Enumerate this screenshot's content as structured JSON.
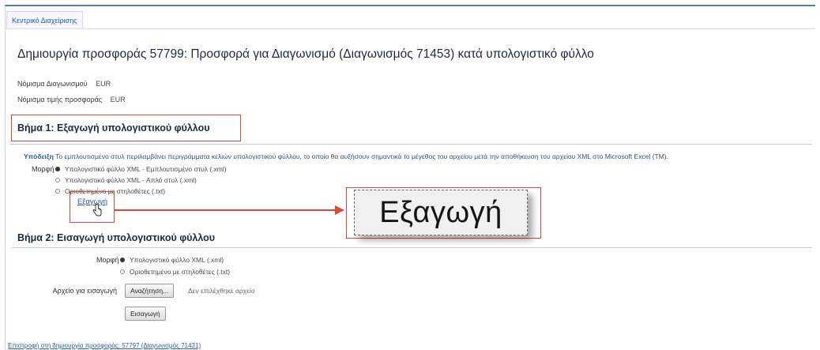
{
  "tab": {
    "label": "Κεντρικό Διαχείρισης"
  },
  "page": {
    "title": "Δημιουργία προσφοράς 57799: Προσφορά για Διαγωνισμό (Διαγωνισμός 71453) κατά υπολογιστικό φύλλο"
  },
  "info": {
    "auction_currency_label": "Νόμισμα Διαγωνισμού",
    "auction_currency_value": "EUR",
    "bid_currency_label": "Νόμισμα τιμής προσφοράς",
    "bid_currency_value": "EUR"
  },
  "step1": {
    "title": "Βήμα 1: Εξαγωγή υπολογιστικού φύλλου",
    "tip_label": "Υπόδειξη",
    "tip_text": "Το εμπλουτισμένο στυλ περιλαμβάνει περιγράμματα κελιών υπολογιστικού φύλλου, το οποίο θα αυξήσουν σημαντικά το μέγεθος του αρχείου μετά την αποθήκευση του αρχείου XML στο Microsoft Excel (TM).",
    "format_label": "Μορφή",
    "options": [
      {
        "label": "Υπολογιστικό φύλλο XML - Εμπλουτισμένο στυλ (.xml)",
        "selected": true
      },
      {
        "label": "Υπολογιστικό φύλλο XML - Απλό στυλ (.xml)",
        "selected": false
      },
      {
        "label": "Οριοθετημένο με στηλοθέτες (.txt)",
        "selected": false
      }
    ],
    "export_link": "Εξαγωγή",
    "callout_text": "Εξαγωγή"
  },
  "step2": {
    "title": "Βήμα 2: Εισαγωγή υπολογιστικού φύλλου",
    "format_label": "Μορφή",
    "options": [
      {
        "label": "Υπολογιστικό φύλλο XML (.xml)",
        "selected": true
      },
      {
        "label": "Οριοθετημένο με στηλοθέτες (.txt)",
        "selected": false
      }
    ],
    "file_label": "Αρχείο για εισαγωγή",
    "browse_button": "Αναζήτηση...",
    "file_note": "Δεν επιλέχθηκε αρχείο",
    "import_button": "Εισαγωγή"
  },
  "footer": {
    "link": "Επιστροφή στη δημιουργία προσφοράς: 57797 (Διαγωνισμός 71431)"
  },
  "colors": {
    "accent": "#2d5a9a",
    "highlight": "#e0463f"
  }
}
